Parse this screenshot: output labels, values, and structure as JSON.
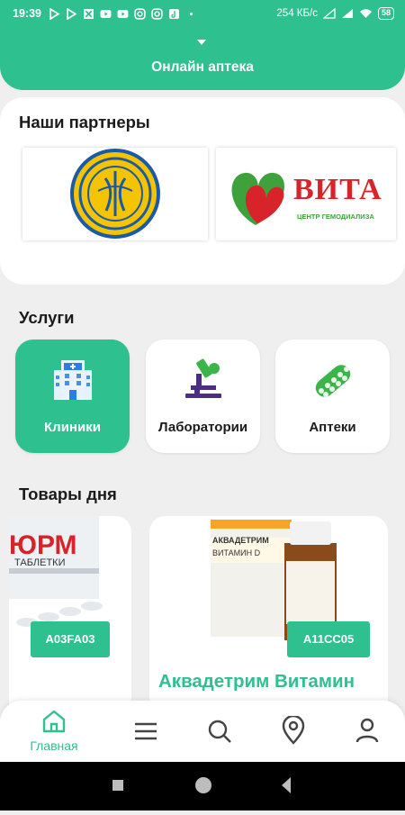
{
  "status_bar": {
    "time": "19:39",
    "speed": "254 КБ/с",
    "battery": "58",
    "icons": [
      "play-store-icon",
      "play-store-icon",
      "image-icon",
      "youtube-icon",
      "youtube-icon",
      "instagram-icon",
      "instagram-icon",
      "tiktok-icon",
      "more-dots-icon"
    ]
  },
  "header": {
    "title": "Онлайн аптека"
  },
  "partners": {
    "title": "Наши партнеры",
    "items": [
      {
        "name": "ministry-logo"
      },
      {
        "name": "vita-logo",
        "logo_text": "ВИТА",
        "logo_subtext": "ЦЕНТР ГЕМОДИАЛИЗА"
      }
    ]
  },
  "services": {
    "title": "Услуги",
    "items": [
      {
        "label": "Клиники",
        "icon": "hospital-icon",
        "active": true
      },
      {
        "label": "Лаборатории",
        "icon": "microscope-icon",
        "active": false
      },
      {
        "label": "Аптеки",
        "icon": "pills-icon",
        "active": false
      }
    ]
  },
  "products": {
    "title": "Товары дня",
    "items": [
      {
        "code": "A03FA03",
        "package_text": "ЮРМ",
        "package_subtext": "ТАБЛЕТКИ"
      },
      {
        "code": "A11CC05",
        "name": "Аквадетрим Витамин",
        "package_text": "АКВАДЕТРИМ",
        "package_subtext": "ВИТАМИН D"
      }
    ]
  },
  "bottom_nav": {
    "items": [
      {
        "label": "Главная",
        "icon": "home-icon"
      },
      {
        "label": "",
        "icon": "menu-icon"
      },
      {
        "label": "",
        "icon": "search-icon"
      },
      {
        "label": "",
        "icon": "location-icon"
      },
      {
        "label": "",
        "icon": "profile-icon"
      }
    ]
  },
  "colors": {
    "accent": "#2ec08f",
    "background": "#efefef",
    "text": "#1b1b1b"
  }
}
